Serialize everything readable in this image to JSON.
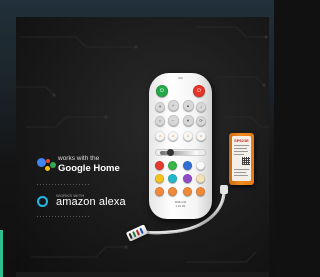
{
  "google_badge": {
    "line1": "works with the",
    "line2": "Google Home",
    "dot_colors": [
      "#4285f4",
      "#ea4335",
      "#fbbc05",
      "#34a853"
    ]
  },
  "alexa_badge": {
    "tiny": "WORKS WITH",
    "text": "amazon alexa",
    "ring_color": "#22b8e6"
  },
  "remote": {
    "bottom_text_1": "RGB+CW",
    "bottom_text_2": "2.4G RF"
  },
  "controller": {
    "title": "SP621E"
  },
  "colors": {
    "power_on": "#24a84a",
    "power_off": "#e53528",
    "accent": "#2fbf8f",
    "controller_orange": "#f08b1f"
  }
}
